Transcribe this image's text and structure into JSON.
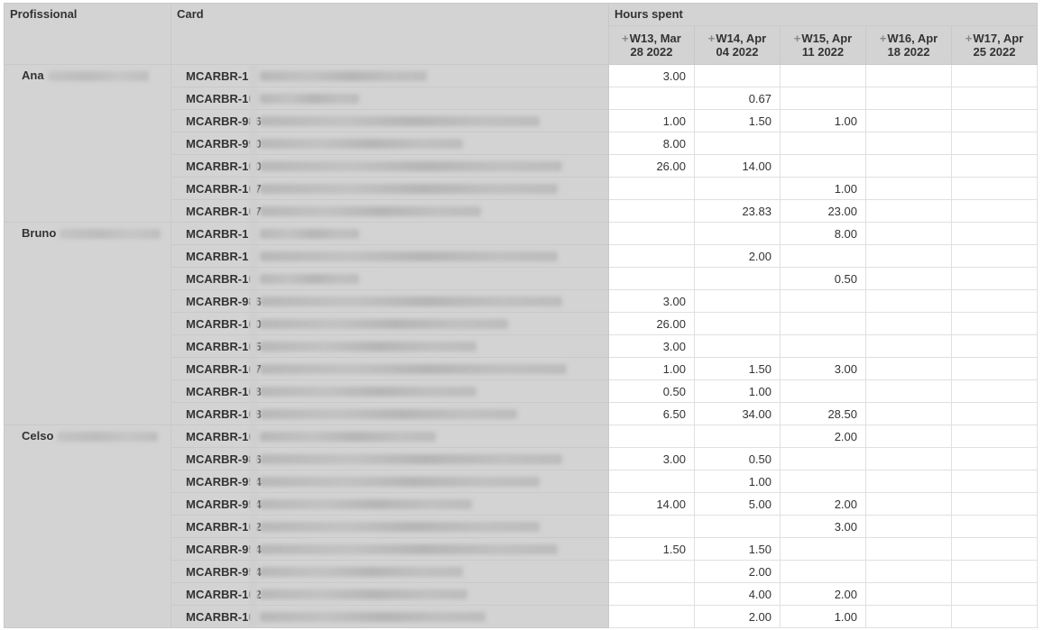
{
  "headers": {
    "professional": "Profissional",
    "card": "Card",
    "hours_spent": "Hours spent",
    "weeks": [
      {
        "line1": "W13, Mar",
        "line2": "28 2022"
      },
      {
        "line1": "W14, Apr",
        "line2": "04 2022"
      },
      {
        "line1": "W15, Apr",
        "line2": "11 2022"
      },
      {
        "line1": "W16, Apr",
        "line2": "18 2022"
      },
      {
        "line1": "W17, Apr",
        "line2": "25 2022"
      }
    ],
    "expand_icon": "plus-icon"
  },
  "groups": [
    {
      "professional": "Ana",
      "rows": [
        {
          "card": "MCARBR-1 /",
          "hours": [
            "3.00",
            "",
            "",
            "",
            ""
          ]
        },
        {
          "card": "MCARBR-10",
          "hours": [
            "",
            "0.67",
            "",
            "",
            ""
          ]
        },
        {
          "card": "MCARBR-986",
          "hours": [
            "1.00",
            "1.50",
            "1.00",
            "",
            ""
          ]
        },
        {
          "card": "MCARBR-990",
          "hours": [
            "8.00",
            "",
            "",
            "",
            ""
          ]
        },
        {
          "card": "MCARBR-100",
          "hours": [
            "26.00",
            "14.00",
            "",
            "",
            ""
          ]
        },
        {
          "card": "MCARBR-107",
          "hours": [
            "",
            "",
            "1.00",
            "",
            ""
          ]
        },
        {
          "card": "MCARBR-107",
          "hours": [
            "",
            "23.83",
            "23.00",
            "",
            ""
          ]
        }
      ]
    },
    {
      "professional": "Bruno",
      "rows": [
        {
          "card": "MCARBR-1 /",
          "hours": [
            "",
            "",
            "8.00",
            "",
            ""
          ]
        },
        {
          "card": "MCARBR-1 /",
          "hours": [
            "",
            "2.00",
            "",
            "",
            ""
          ]
        },
        {
          "card": "MCARBR-10",
          "hours": [
            "",
            "",
            "0.50",
            "",
            ""
          ]
        },
        {
          "card": "MCARBR-986",
          "hours": [
            "3.00",
            "",
            "",
            "",
            ""
          ]
        },
        {
          "card": "MCARBR-100",
          "hours": [
            "26.00",
            "",
            "",
            "",
            ""
          ]
        },
        {
          "card": "MCARBR-105",
          "hours": [
            "3.00",
            "",
            "",
            "",
            ""
          ]
        },
        {
          "card": "MCARBR-107",
          "hours": [
            "1.00",
            "1.50",
            "3.00",
            "",
            ""
          ]
        },
        {
          "card": "MCARBR-108",
          "hours": [
            "0.50",
            "1.00",
            "",
            "",
            ""
          ]
        },
        {
          "card": "MCARBR-108",
          "hours": [
            "6.50",
            "34.00",
            "28.50",
            "",
            ""
          ]
        }
      ]
    },
    {
      "professional": "Celso",
      "rows": [
        {
          "card": "MCARBR-10",
          "hours": [
            "",
            "",
            "2.00",
            "",
            ""
          ]
        },
        {
          "card": "MCARBR-986",
          "hours": [
            "3.00",
            "0.50",
            "",
            "",
            ""
          ]
        },
        {
          "card": "MCARBR-954",
          "hours": [
            "",
            "1.00",
            "",
            "",
            ""
          ]
        },
        {
          "card": "MCARBR-954",
          "hours": [
            "14.00",
            "5.00",
            "2.00",
            "",
            ""
          ]
        },
        {
          "card": "MCARBR-102",
          "hours": [
            "",
            "",
            "3.00",
            "",
            ""
          ]
        },
        {
          "card": "MCARBR-954",
          "hours": [
            "1.50",
            "1.50",
            "",
            "",
            ""
          ]
        },
        {
          "card": "MCARBR-954",
          "hours": [
            "",
            "2.00",
            "",
            "",
            ""
          ]
        },
        {
          "card": "MCARBR-102",
          "hours": [
            "",
            "4.00",
            "2.00",
            "",
            ""
          ]
        },
        {
          "card": "MCARBR-10",
          "hours": [
            "",
            "2.00",
            "1.00",
            "",
            ""
          ]
        }
      ]
    }
  ]
}
